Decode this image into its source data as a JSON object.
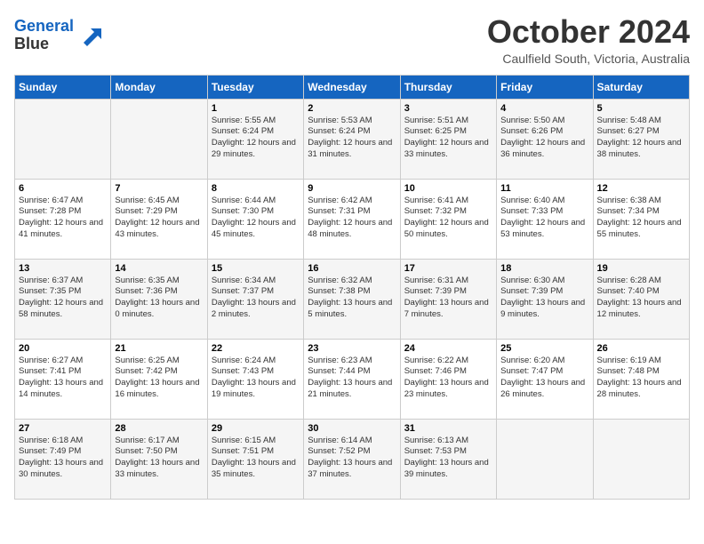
{
  "app": {
    "logo_line1": "General",
    "logo_line2": "Blue"
  },
  "title": "October 2024",
  "location": "Caulfield South, Victoria, Australia",
  "days_of_week": [
    "Sunday",
    "Monday",
    "Tuesday",
    "Wednesday",
    "Thursday",
    "Friday",
    "Saturday"
  ],
  "weeks": [
    [
      {
        "day": "",
        "sunrise": "",
        "sunset": "",
        "daylight": ""
      },
      {
        "day": "",
        "sunrise": "",
        "sunset": "",
        "daylight": ""
      },
      {
        "day": "1",
        "sunrise": "Sunrise: 5:55 AM",
        "sunset": "Sunset: 6:24 PM",
        "daylight": "Daylight: 12 hours and 29 minutes."
      },
      {
        "day": "2",
        "sunrise": "Sunrise: 5:53 AM",
        "sunset": "Sunset: 6:24 PM",
        "daylight": "Daylight: 12 hours and 31 minutes."
      },
      {
        "day": "3",
        "sunrise": "Sunrise: 5:51 AM",
        "sunset": "Sunset: 6:25 PM",
        "daylight": "Daylight: 12 hours and 33 minutes."
      },
      {
        "day": "4",
        "sunrise": "Sunrise: 5:50 AM",
        "sunset": "Sunset: 6:26 PM",
        "daylight": "Daylight: 12 hours and 36 minutes."
      },
      {
        "day": "5",
        "sunrise": "Sunrise: 5:48 AM",
        "sunset": "Sunset: 6:27 PM",
        "daylight": "Daylight: 12 hours and 38 minutes."
      }
    ],
    [
      {
        "day": "6",
        "sunrise": "Sunrise: 6:47 AM",
        "sunset": "Sunset: 7:28 PM",
        "daylight": "Daylight: 12 hours and 41 minutes."
      },
      {
        "day": "7",
        "sunrise": "Sunrise: 6:45 AM",
        "sunset": "Sunset: 7:29 PM",
        "daylight": "Daylight: 12 hours and 43 minutes."
      },
      {
        "day": "8",
        "sunrise": "Sunrise: 6:44 AM",
        "sunset": "Sunset: 7:30 PM",
        "daylight": "Daylight: 12 hours and 45 minutes."
      },
      {
        "day": "9",
        "sunrise": "Sunrise: 6:42 AM",
        "sunset": "Sunset: 7:31 PM",
        "daylight": "Daylight: 12 hours and 48 minutes."
      },
      {
        "day": "10",
        "sunrise": "Sunrise: 6:41 AM",
        "sunset": "Sunset: 7:32 PM",
        "daylight": "Daylight: 12 hours and 50 minutes."
      },
      {
        "day": "11",
        "sunrise": "Sunrise: 6:40 AM",
        "sunset": "Sunset: 7:33 PM",
        "daylight": "Daylight: 12 hours and 53 minutes."
      },
      {
        "day": "12",
        "sunrise": "Sunrise: 6:38 AM",
        "sunset": "Sunset: 7:34 PM",
        "daylight": "Daylight: 12 hours and 55 minutes."
      }
    ],
    [
      {
        "day": "13",
        "sunrise": "Sunrise: 6:37 AM",
        "sunset": "Sunset: 7:35 PM",
        "daylight": "Daylight: 12 hours and 58 minutes."
      },
      {
        "day": "14",
        "sunrise": "Sunrise: 6:35 AM",
        "sunset": "Sunset: 7:36 PM",
        "daylight": "Daylight: 13 hours and 0 minutes."
      },
      {
        "day": "15",
        "sunrise": "Sunrise: 6:34 AM",
        "sunset": "Sunset: 7:37 PM",
        "daylight": "Daylight: 13 hours and 2 minutes."
      },
      {
        "day": "16",
        "sunrise": "Sunrise: 6:32 AM",
        "sunset": "Sunset: 7:38 PM",
        "daylight": "Daylight: 13 hours and 5 minutes."
      },
      {
        "day": "17",
        "sunrise": "Sunrise: 6:31 AM",
        "sunset": "Sunset: 7:39 PM",
        "daylight": "Daylight: 13 hours and 7 minutes."
      },
      {
        "day": "18",
        "sunrise": "Sunrise: 6:30 AM",
        "sunset": "Sunset: 7:39 PM",
        "daylight": "Daylight: 13 hours and 9 minutes."
      },
      {
        "day": "19",
        "sunrise": "Sunrise: 6:28 AM",
        "sunset": "Sunset: 7:40 PM",
        "daylight": "Daylight: 13 hours and 12 minutes."
      }
    ],
    [
      {
        "day": "20",
        "sunrise": "Sunrise: 6:27 AM",
        "sunset": "Sunset: 7:41 PM",
        "daylight": "Daylight: 13 hours and 14 minutes."
      },
      {
        "day": "21",
        "sunrise": "Sunrise: 6:25 AM",
        "sunset": "Sunset: 7:42 PM",
        "daylight": "Daylight: 13 hours and 16 minutes."
      },
      {
        "day": "22",
        "sunrise": "Sunrise: 6:24 AM",
        "sunset": "Sunset: 7:43 PM",
        "daylight": "Daylight: 13 hours and 19 minutes."
      },
      {
        "day": "23",
        "sunrise": "Sunrise: 6:23 AM",
        "sunset": "Sunset: 7:44 PM",
        "daylight": "Daylight: 13 hours and 21 minutes."
      },
      {
        "day": "24",
        "sunrise": "Sunrise: 6:22 AM",
        "sunset": "Sunset: 7:46 PM",
        "daylight": "Daylight: 13 hours and 23 minutes."
      },
      {
        "day": "25",
        "sunrise": "Sunrise: 6:20 AM",
        "sunset": "Sunset: 7:47 PM",
        "daylight": "Daylight: 13 hours and 26 minutes."
      },
      {
        "day": "26",
        "sunrise": "Sunrise: 6:19 AM",
        "sunset": "Sunset: 7:48 PM",
        "daylight": "Daylight: 13 hours and 28 minutes."
      }
    ],
    [
      {
        "day": "27",
        "sunrise": "Sunrise: 6:18 AM",
        "sunset": "Sunset: 7:49 PM",
        "daylight": "Daylight: 13 hours and 30 minutes."
      },
      {
        "day": "28",
        "sunrise": "Sunrise: 6:17 AM",
        "sunset": "Sunset: 7:50 PM",
        "daylight": "Daylight: 13 hours and 33 minutes."
      },
      {
        "day": "29",
        "sunrise": "Sunrise: 6:15 AM",
        "sunset": "Sunset: 7:51 PM",
        "daylight": "Daylight: 13 hours and 35 minutes."
      },
      {
        "day": "30",
        "sunrise": "Sunrise: 6:14 AM",
        "sunset": "Sunset: 7:52 PM",
        "daylight": "Daylight: 13 hours and 37 minutes."
      },
      {
        "day": "31",
        "sunrise": "Sunrise: 6:13 AM",
        "sunset": "Sunset: 7:53 PM",
        "daylight": "Daylight: 13 hours and 39 minutes."
      },
      {
        "day": "",
        "sunrise": "",
        "sunset": "",
        "daylight": ""
      },
      {
        "day": "",
        "sunrise": "",
        "sunset": "",
        "daylight": ""
      }
    ]
  ]
}
